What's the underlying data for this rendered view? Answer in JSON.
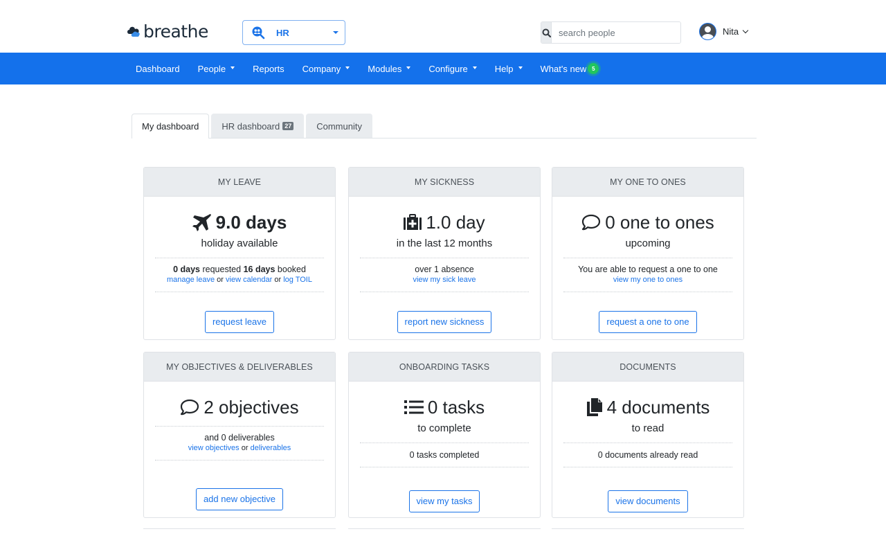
{
  "header": {
    "logo_text": "breathe",
    "module_selector": {
      "label": "HR",
      "icon": "people-search-icon"
    },
    "search": {
      "placeholder": "search people",
      "value": ""
    },
    "user": {
      "name": "Nita"
    }
  },
  "nav": {
    "items": [
      {
        "label": "Dashboard",
        "dropdown": false
      },
      {
        "label": "People",
        "dropdown": true
      },
      {
        "label": "Reports",
        "dropdown": false
      },
      {
        "label": "Company",
        "dropdown": true
      },
      {
        "label": "Modules",
        "dropdown": true
      },
      {
        "label": "Configure",
        "dropdown": true
      },
      {
        "label": "Help",
        "dropdown": true
      },
      {
        "label": "What's new",
        "dropdown": false,
        "badge": "5"
      }
    ],
    "color": "#1471eb",
    "badge_color": "#22c55e"
  },
  "tabs": [
    {
      "label": "My dashboard",
      "active": true
    },
    {
      "label": "HR dashboard",
      "count": "27",
      "active": false
    },
    {
      "label": "Community",
      "active": false
    }
  ],
  "cards": {
    "leave": {
      "title": "MY LEAVE",
      "icon": "plane-icon",
      "headline": "9.0 days",
      "sub": "holiday available",
      "requested_value": "0 days",
      "requested_label": "requested",
      "booked_value": "16 days",
      "booked_label": "booked",
      "links": [
        "manage leave",
        "view calendar",
        "log TOIL"
      ],
      "link_sep": "or",
      "button": "request leave"
    },
    "sickness": {
      "title": "MY SICKNESS",
      "icon": "medkit-icon",
      "headline": "1.0 day",
      "sub": "in the last 12 months",
      "info": "over 1 absence",
      "link": "view my sick leave",
      "button": "report new sickness"
    },
    "one_to_ones": {
      "title": "MY ONE TO ONES",
      "icon": "comment-icon",
      "headline": "0 one to ones",
      "sub": "upcoming",
      "info": "You are able to request a one to one",
      "link": "view my one to ones",
      "button": "request a one to one"
    },
    "objectives": {
      "title": "MY OBJECTIVES & DELIVERABLES",
      "icon": "comment-icon",
      "headline": "2 objectives",
      "info": "and 0 deliverables",
      "links": [
        "view objectives",
        "deliverables"
      ],
      "link_sep": "or",
      "button": "add new objective"
    },
    "onboarding": {
      "title": "ONBOARDING TASKS",
      "icon": "list-icon",
      "headline": "0 tasks",
      "sub": "to complete",
      "info": "0 tasks completed",
      "button": "view my tasks"
    },
    "documents": {
      "title": "DOCUMENTS",
      "icon": "copy-icon",
      "headline": "4 documents",
      "sub": "to read",
      "info": "0 documents already read",
      "button": "view documents"
    }
  }
}
